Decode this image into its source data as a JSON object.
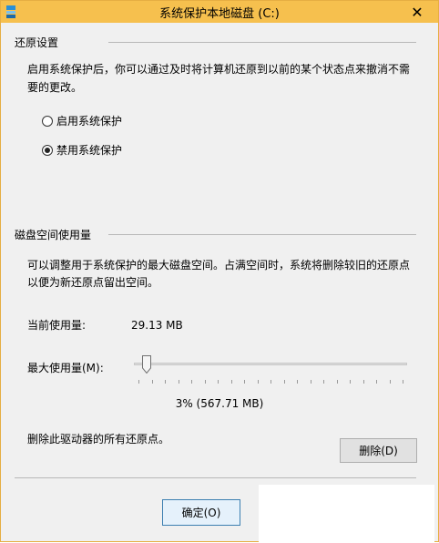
{
  "window": {
    "title": "系统保护本地磁盘 (C:)",
    "close_glyph": "✕"
  },
  "restore": {
    "section_title": "还原设置",
    "description_line1": "启用系统保护后，你可以通过及时将计算机还原到以前的某个状态点来撤消不需",
    "description_line2": "要的更改。",
    "options": [
      {
        "label": "启用系统保护",
        "selected": false
      },
      {
        "label": "禁用系统保护",
        "selected": true
      }
    ]
  },
  "disk": {
    "section_title": "磁盘空间使用量",
    "description_line1": "可以调整用于系统保护的最大磁盘空间。占满空间时，系统将删除较旧的还原点",
    "description_line2": "以便为新还原点留出空间。",
    "current_label": "当前使用量:",
    "current_value": "29.13 MB",
    "max_label": "最大使用量(M):",
    "max_percent": 3,
    "max_readout": "3% (567.71 MB)",
    "delete_text": "删除此驱动器的所有还原点。",
    "delete_button": "删除(D)"
  },
  "footer": {
    "ok_button": "确定(O)"
  },
  "colors": {
    "titlebar": "#f6c04e",
    "dialog_bg": "#f0f0f0"
  }
}
